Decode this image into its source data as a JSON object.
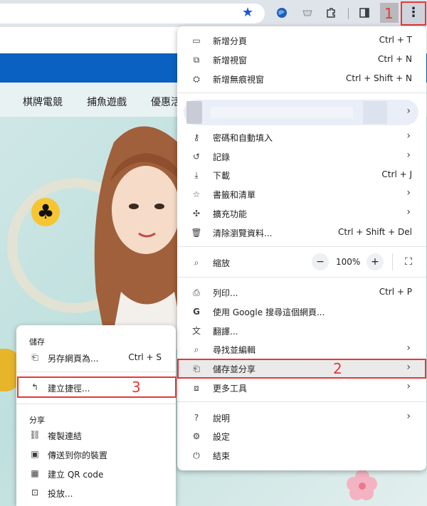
{
  "toolbar": {
    "step1": "1",
    "icons": [
      "star-icon",
      "extension-globe-icon",
      "extension-cup-icon",
      "puzzle-icon",
      "side-panel-icon",
      "kebab-menu-icon"
    ]
  },
  "site": {
    "nav": [
      "棋牌電競",
      "捕魚遊戲",
      "優惠活"
    ]
  },
  "menu": {
    "new_tab": "新增分頁",
    "new_tab_sc": "Ctrl + T",
    "new_window": "新增視窗",
    "new_window_sc": "Ctrl + N",
    "incognito": "新增無痕視窗",
    "incognito_sc": "Ctrl + Shift + N",
    "passwords": "密碼和自動填入",
    "history": "記錄",
    "downloads": "下載",
    "downloads_sc": "Ctrl + J",
    "bookmarks": "書籤和清單",
    "extensions": "擴充功能",
    "clear_data": "清除瀏覽資料...",
    "clear_data_sc": "Ctrl + Shift + Del",
    "zoom": "縮放",
    "zoom_minus": "−",
    "zoom_value": "100%",
    "zoom_plus": "+",
    "print": "列印...",
    "print_sc": "Ctrl + P",
    "google_search": "使用 Google 搜尋這個網頁...",
    "translate": "翻譯...",
    "find_edit": "尋找並編輯",
    "save_share": "儲存並分享",
    "step2": "2",
    "more_tools": "更多工具",
    "help": "說明",
    "settings": "設定",
    "exit": "結束",
    "arrow": "›"
  },
  "submenu": {
    "save_heading": "儲存",
    "save_page": "另存網頁為...",
    "save_page_sc": "Ctrl + S",
    "create_shortcut": "建立捷徑...",
    "step3": "3",
    "share_heading": "分享",
    "copy_link": "複製連結",
    "send_devices": "傳送到你的裝置",
    "qr_code": "建立 QR code",
    "cast": "投放..."
  },
  "colors": {
    "accent_red": "#e53935",
    "site_blue": "#0a61c1",
    "star_blue": "#1a56d9"
  }
}
